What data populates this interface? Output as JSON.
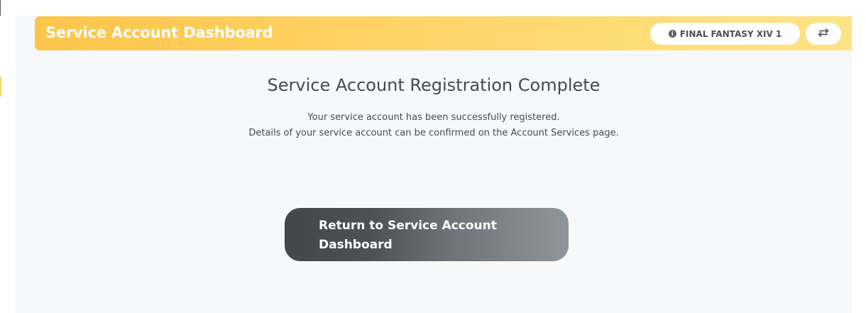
{
  "header": {
    "title": "Service Account Dashboard",
    "game_selector": {
      "icon": "info-icon",
      "icon_glyph": "i",
      "label": "FINAL FANTASY XIV 1"
    },
    "switch_button": {
      "icon": "swap-arrows-icon"
    }
  },
  "main": {
    "heading": "Service Account Registration Complete",
    "message_lines": [
      "Your service account has been successfully registered.",
      "Details of your service account can be confirmed on the Account Services page."
    ],
    "return_button": {
      "label": "Return to Service Account Dashboard"
    }
  },
  "colors": {
    "header_gradient_start": "#fcc54a",
    "header_gradient_end": "#fee485",
    "button_gradient_start": "#43474b",
    "button_gradient_end": "#8e959b",
    "text": "#454a50",
    "page_background": "#f7f8fa"
  }
}
